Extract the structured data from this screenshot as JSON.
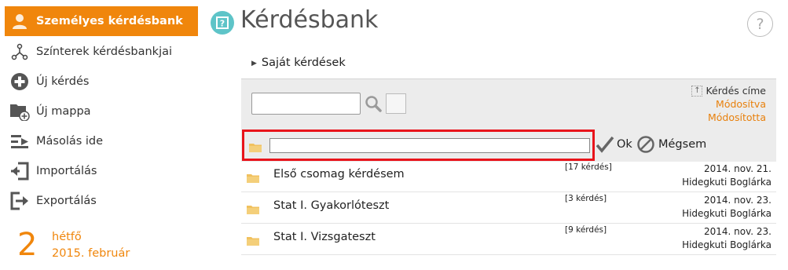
{
  "sidebar": {
    "items": [
      {
        "label": "Személyes kérdésbank",
        "icon": "person-icon",
        "active": true
      },
      {
        "label": "Színterek kérdésbankjai",
        "icon": "share-network-icon",
        "active": false
      },
      {
        "label": "Új kérdés",
        "icon": "plus-circle-icon",
        "active": false
      },
      {
        "label": "Új mappa",
        "icon": "folder-plus-icon",
        "active": false
      },
      {
        "label": "Másolás ide",
        "icon": "copy-here-icon",
        "active": false
      },
      {
        "label": "Importálás",
        "icon": "import-icon",
        "active": false
      },
      {
        "label": "Exportálás",
        "icon": "export-icon",
        "active": false
      }
    ],
    "date": {
      "day": "2",
      "weekday": "hétfő",
      "month_year": "2015. február"
    }
  },
  "header": {
    "title": "Kérdésbank",
    "help": "?"
  },
  "breadcrumb": {
    "label": "Saját kérdések"
  },
  "toolbar": {
    "search_value": "",
    "sort_options": {
      "title": "Kérdés címe",
      "modified": "Módosítva",
      "modified_by": "Módosította"
    }
  },
  "new_folder": {
    "input_value": "",
    "ok_label": "Ok",
    "cancel_label": "Mégsem"
  },
  "list": {
    "rows": [
      {
        "name": "Első csomag kérdésem",
        "count": "[17 kérdés]",
        "date": "2014. nov. 21.",
        "author": "Hidegkuti Boglárka"
      },
      {
        "name": "Stat I. Gyakorlóteszt",
        "count": "[3 kérdés]",
        "date": "2014. nov. 23.",
        "author": "Hidegkuti Boglárka"
      },
      {
        "name": "Stat I. Vizsgateszt",
        "count": "[9 kérdés]",
        "date": "2014. nov. 23.",
        "author": "Hidegkuti Boglárka"
      }
    ]
  },
  "colors": {
    "accent": "#f0860c",
    "highlight": "#e8141b",
    "folder": "#f1c15e",
    "title_icon": "#5ec4c8"
  }
}
